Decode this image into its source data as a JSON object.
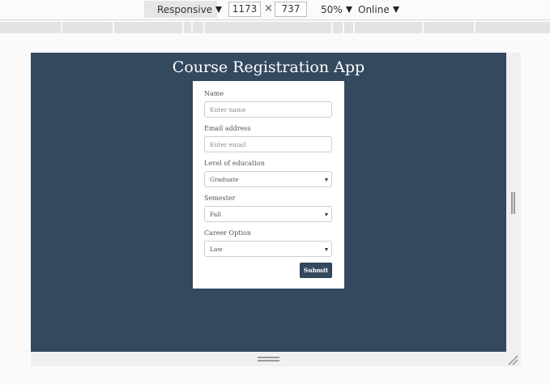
{
  "devtools": {
    "device": "Responsive",
    "width": "1173",
    "times": "×",
    "height": "737",
    "zoom": "50%",
    "network": "Online"
  },
  "app": {
    "title": "Course Registration App",
    "form": {
      "name_label": "Name",
      "name_placeholder": "Enter name",
      "email_label": "Email address",
      "email_placeholder": "Enter email",
      "education_label": "Level of education",
      "education_value": "Graduate",
      "semester_label": "Semester",
      "semester_value": "Fall",
      "career_label": "Career Option",
      "career_value": "Law",
      "submit_label": "Submit"
    }
  },
  "colors": {
    "device_bg": "#34495e",
    "submit_bg": "#34495e"
  }
}
